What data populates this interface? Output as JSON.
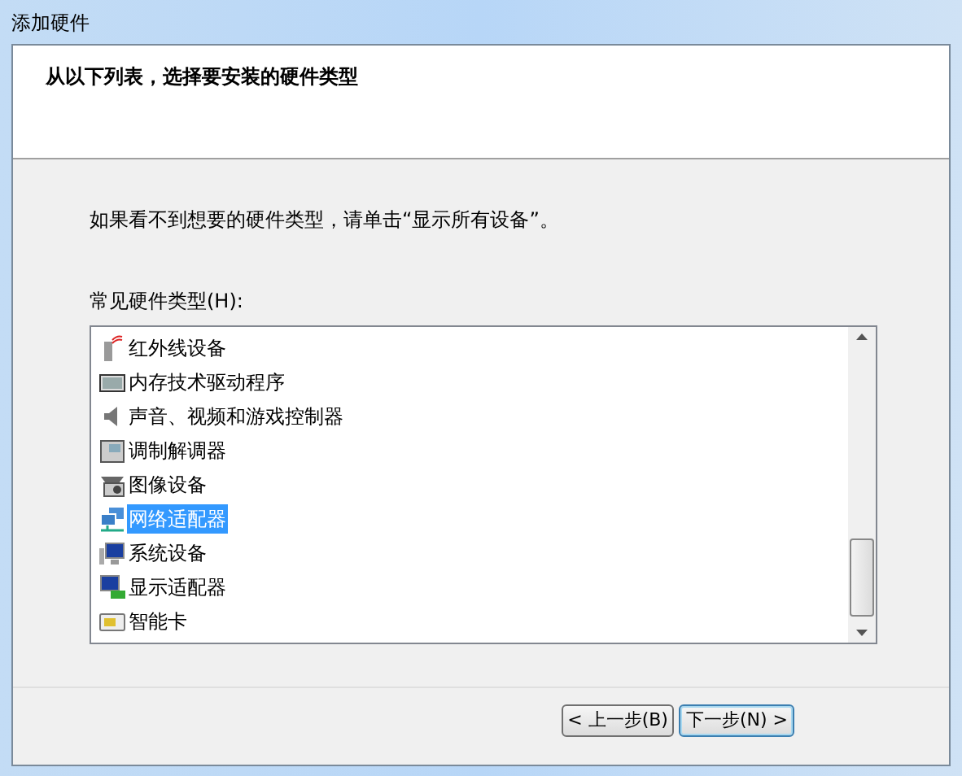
{
  "window": {
    "title": "添加硬件"
  },
  "header": {
    "title": "从以下列表，选择要安装的硬件类型"
  },
  "instruction": "如果看不到想要的硬件类型，请单击“显示所有设备”。",
  "list_label": "常见硬件类型(H):",
  "hardware_types": [
    {
      "label": "红外线设备",
      "kind": "infrared",
      "selected": false
    },
    {
      "label": "内存技术驱动程序",
      "kind": "memory",
      "selected": false
    },
    {
      "label": "声音、视频和游戏控制器",
      "kind": "sound",
      "selected": false
    },
    {
      "label": "调制解调器",
      "kind": "modem",
      "selected": false
    },
    {
      "label": "图像设备",
      "kind": "camera",
      "selected": false
    },
    {
      "label": "网络适配器",
      "kind": "network",
      "selected": true
    },
    {
      "label": "系统设备",
      "kind": "system",
      "selected": false
    },
    {
      "label": "显示适配器",
      "kind": "display",
      "selected": false
    },
    {
      "label": "智能卡",
      "kind": "smartcard",
      "selected": false
    }
  ],
  "buttons": [
    {
      "label": "< 上一步(B)",
      "focused": false
    },
    {
      "label": "下一步(N) >",
      "focused": true
    }
  ]
}
